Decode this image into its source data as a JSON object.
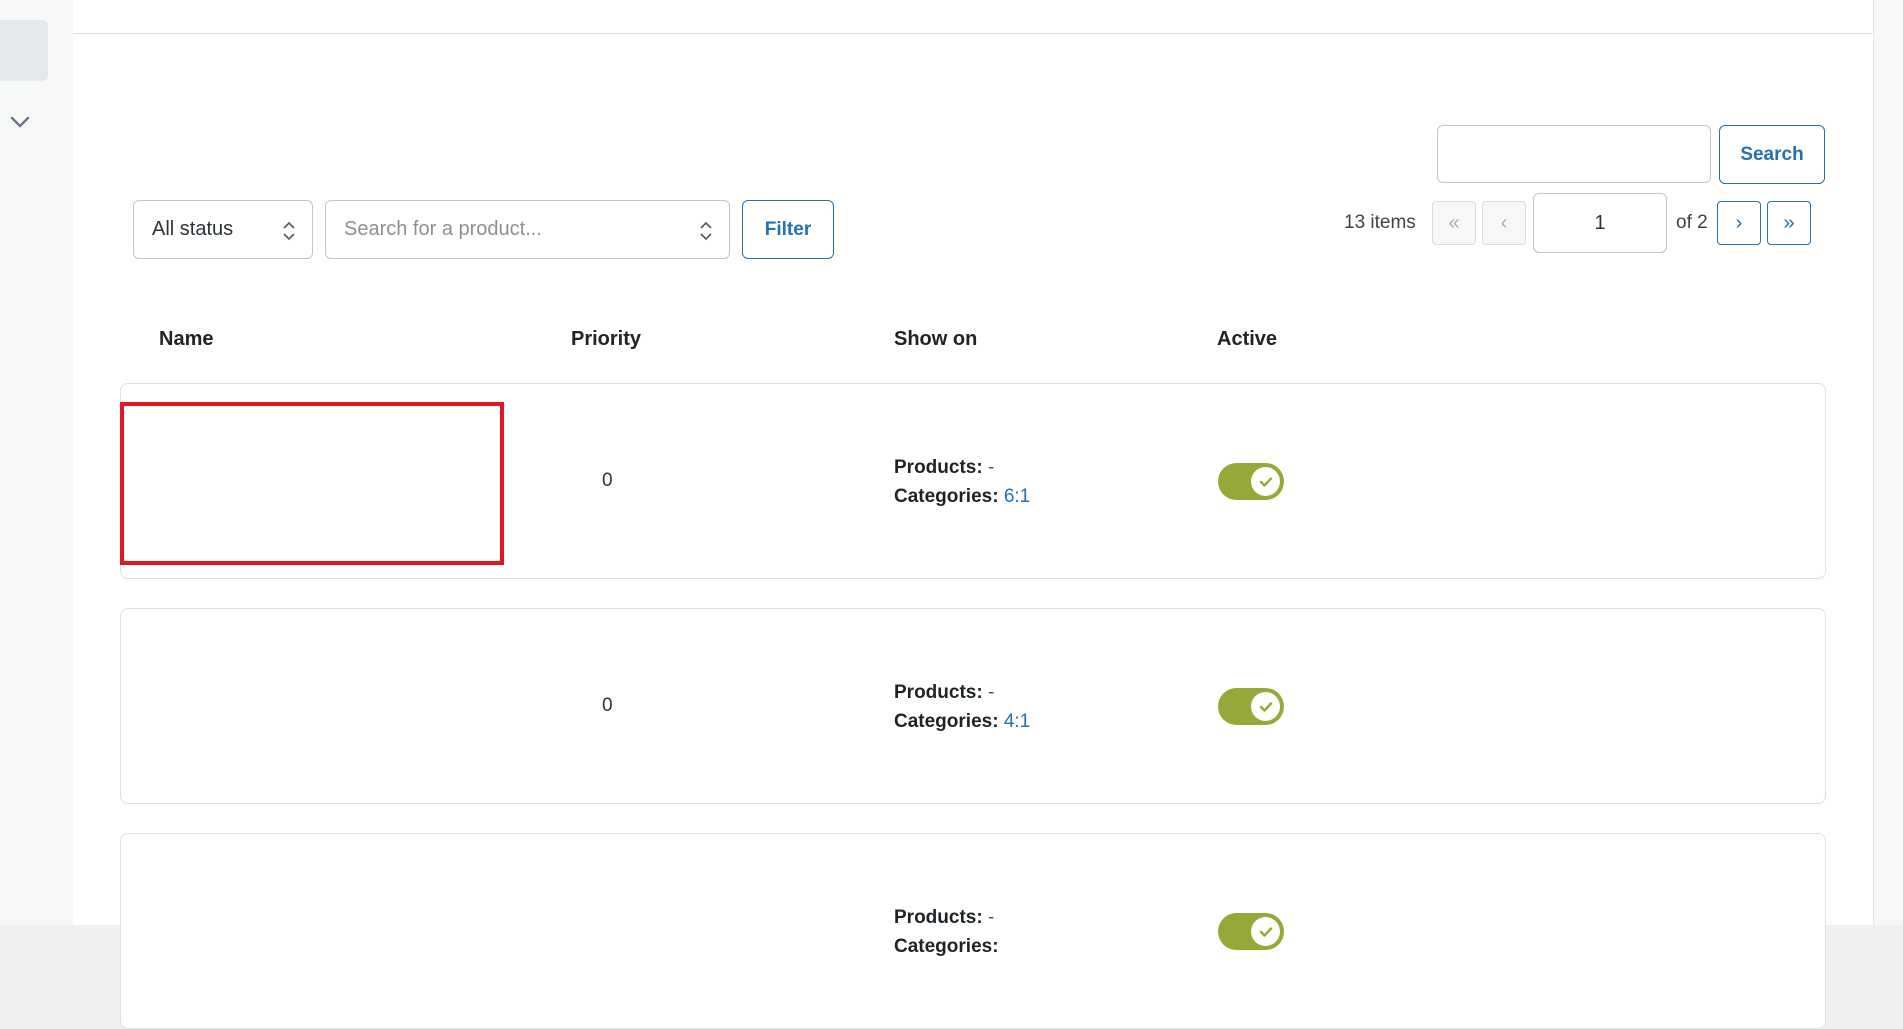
{
  "search": {
    "input_value": "",
    "button_label": "Search"
  },
  "filters": {
    "status_selected": "All status",
    "product_placeholder": "Search for a product...",
    "filter_label": "Filter"
  },
  "pagination": {
    "items_count": "13 items",
    "first": "«",
    "prev": "‹",
    "current_page": "1",
    "of_pages": "of 2",
    "next": "›",
    "last": "»"
  },
  "table": {
    "headers": {
      "name": "Name",
      "priority": "Priority",
      "show_on": "Show on",
      "active": "Active"
    },
    "rows": [
      {
        "name": "",
        "priority": "0",
        "products_label": "Products:",
        "products_value": "-",
        "categories_label": "Categories:",
        "categories_value": "6:1",
        "active": true
      },
      {
        "name": "",
        "priority": "0",
        "products_label": "Products:",
        "products_value": "-",
        "categories_label": "Categories:",
        "categories_value": "4:1",
        "active": true
      },
      {
        "name": "",
        "priority": "",
        "products_label": "Products:",
        "products_value": "-",
        "categories_label": "Categories:",
        "categories_value": "",
        "active": true
      }
    ]
  },
  "colors": {
    "accent": "#2271b1",
    "toggle_on": "#98a838",
    "highlight": "#e0181e"
  }
}
